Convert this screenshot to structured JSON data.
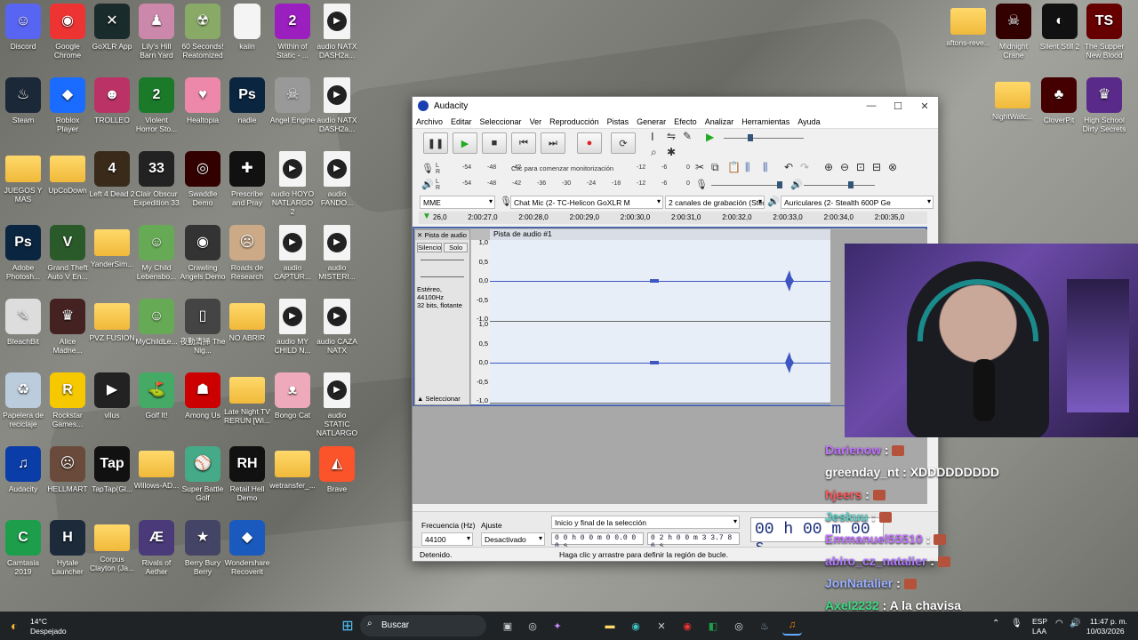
{
  "desktop_left": [
    {
      "label": "Discord",
      "bg": "#5865f2",
      "g": "☺"
    },
    {
      "label": "Google Chrome",
      "bg": "#e33",
      "g": "◉"
    },
    {
      "label": "GoXLR App",
      "bg": "#1a2b2b",
      "g": "✕"
    },
    {
      "label": "Lily's Hill Barn Yard",
      "bg": "#c8a",
      "g": "♟"
    },
    {
      "label": "60 Seconds! Reatomized",
      "bg": "#8a6",
      "g": "☢"
    },
    {
      "label": "kaiin",
      "file": true
    },
    {
      "label": "Within of Static - ...",
      "bg": "#9b1ebf",
      "g": "2"
    },
    {
      "label": "audio NATX DASH2a...",
      "audio": true
    },
    {
      "label": "Steam",
      "bg": "#1b2838",
      "g": "♨"
    },
    {
      "label": "Roblox Player",
      "bg": "#1a6bff",
      "g": "◆"
    },
    {
      "label": "TROLLEO",
      "bg": "#b36",
      "g": "☻"
    },
    {
      "label": "Violent Horror Sto...",
      "bg": "#1a7a2a",
      "g": "2"
    },
    {
      "label": "Healtopia",
      "bg": "#e8a",
      "g": "♥"
    },
    {
      "label": "nadie",
      "bg": "#0a2540",
      "g": "Ps"
    },
    {
      "label": "Angel Engine",
      "bg": "#999",
      "g": "☠"
    },
    {
      "label": "audio NATX DASH2a...",
      "audio": true
    },
    {
      "label": "JUEGOS Y MAS",
      "folder": true
    },
    {
      "label": "UpCoDown",
      "folder": true
    },
    {
      "label": "Left 4 Dead 2",
      "bg": "#3a2a1a",
      "g": "4"
    },
    {
      "label": "Clair Obscur Expedition 33",
      "bg": "#222",
      "g": "33"
    },
    {
      "label": "Swaddle Demo",
      "bg": "#300",
      "g": "◎"
    },
    {
      "label": "Prescribe and Pray",
      "bg": "#111",
      "g": "✚"
    },
    {
      "label": "audio HOYO NATLARGO 2",
      "audio": true
    },
    {
      "label": "audio FANDO...",
      "audio": true
    },
    {
      "label": "Adobe Photosh...",
      "bg": "#0a2540",
      "g": "Ps"
    },
    {
      "label": "Grand Theft Auto V En...",
      "bg": "#2a5a2a",
      "g": "V"
    },
    {
      "label": "YanderSim...",
      "folder": true
    },
    {
      "label": "My Child Lebensbo...",
      "bg": "#6a5",
      "g": "☺"
    },
    {
      "label": "Crawling Angels Demo",
      "bg": "#333",
      "g": "◉"
    },
    {
      "label": "Roads de Research",
      "bg": "#ca8",
      "g": "☹"
    },
    {
      "label": "audio CAPTUR...",
      "audio": true
    },
    {
      "label": "audio MISTERI...",
      "audio": true
    },
    {
      "label": "BleachBit",
      "bg": "#ddd",
      "g": "✎"
    },
    {
      "label": "Alice Madne...",
      "bg": "#422",
      "g": "♛"
    },
    {
      "label": "PVZ FUSION",
      "folder": true
    },
    {
      "label": "MyChildLe...",
      "bg": "#6a5",
      "g": "☺"
    },
    {
      "label": "夜勤清掃 The Nig...",
      "bg": "#444",
      "g": "▯"
    },
    {
      "label": "NO ABRIR",
      "folder": true
    },
    {
      "label": "audio MY CHILD N...",
      "audio": true
    },
    {
      "label": "audio CAZA NATX",
      "audio": true
    },
    {
      "label": "Papelera de reciclaje",
      "bg": "#bcd",
      "g": "♻"
    },
    {
      "label": "Rockstar Games...",
      "bg": "#f5c800",
      "g": "R"
    },
    {
      "label": "vilus",
      "bg": "#222",
      "g": "▶"
    },
    {
      "label": "Golf It!",
      "bg": "#4a6",
      "g": "⛳"
    },
    {
      "label": "Among Us",
      "bg": "#c00",
      "g": "☗"
    },
    {
      "label": "Late Night TV RERUN [Wi...",
      "folder": true
    },
    {
      "label": "Bongo Cat",
      "bg": "#eab",
      "g": "ᴥ"
    },
    {
      "label": "audio STATIC NATLARGO",
      "audio": true
    },
    {
      "label": "Audacity",
      "bg": "#0a3da8",
      "g": "♫"
    },
    {
      "label": "HELLMART",
      "bg": "#6a4a3a",
      "g": "☹"
    },
    {
      "label": "TapTap(Gl...",
      "bg": "#111",
      "g": "Tap"
    },
    {
      "label": "Willows-AD...",
      "folder": true
    },
    {
      "label": "Super Battle Golf",
      "bg": "#4a8",
      "g": "⚾"
    },
    {
      "label": "Retail Hell Demo",
      "bg": "#111",
      "g": "RH"
    },
    {
      "label": "wetransfer_...",
      "folder": true
    },
    {
      "label": "Brave",
      "bg": "#fb542b",
      "g": "◭"
    },
    {
      "label": "Camtasia 2019",
      "bg": "#1d9e4a",
      "g": "C"
    },
    {
      "label": "Hytale Launcher",
      "bg": "#1c2a3a",
      "g": "H"
    },
    {
      "label": "Corpus Clayton (Ja...",
      "folder": true
    },
    {
      "label": "Rivals of Aether",
      "bg": "#4a3a7a",
      "g": "Æ"
    },
    {
      "label": "Berry Bury Berry",
      "bg": "#446",
      "g": "★"
    },
    {
      "label": "Wondershare Recoverit",
      "bg": "#1a5abf",
      "g": "◆"
    }
  ],
  "desktop_right": [
    {
      "label": "aftons-reve...",
      "folder": true
    },
    {
      "label": "Midnight Crane",
      "bg": "#300",
      "g": "☠"
    },
    {
      "label": "Silent Still 2",
      "bg": "#111",
      "g": "◐"
    },
    {
      "label": "The Supper New Blood",
      "bg": "#600",
      "g": "TS"
    },
    {
      "label": "NightWatc...",
      "folder": true
    },
    {
      "label": "CloverPit",
      "bg": "#400",
      "g": "♣"
    },
    {
      "label": "High School Dirty Secrets",
      "bg": "#5a2a8a",
      "g": "♛"
    }
  ],
  "audacity": {
    "title": "Audacity",
    "menus": [
      "Archivo",
      "Editar",
      "Seleccionar",
      "Ver",
      "Reproducción",
      "Pistas",
      "Generar",
      "Efecto",
      "Analizar",
      "Herramientas",
      "Ayuda"
    ],
    "monitor_text": "Clic para comenzar monitorización",
    "meter_ticks": [
      "-54",
      "-48",
      "-42",
      "-36",
      "-30",
      "-24",
      "-18",
      "-12",
      "-6",
      "0"
    ],
    "host": "MME",
    "input_device": "Chat Mic (2- TC-Helicon GoXLR M",
    "channels": "2 canales de grabación (Ster",
    "output_device": "Auriculares (2- Stealth 600P Ge",
    "ruler": [
      "26,0",
      "2:00:27,0",
      "2:00:28,0",
      "2:00:29,0",
      "2:00:30,0",
      "2:00:31,0",
      "2:00:32,0",
      "2:00:33,0",
      "2:00:34,0",
      "2:00:35,0"
    ],
    "track_name": "Pista de audio #1",
    "track_menu": "Pista de audio",
    "mute": "Silencio",
    "solo": "Solo",
    "track_info": "Estéreo, 44100Hz",
    "track_info2": "32 bits, flotante",
    "select_btn": "Seleccionar",
    "scale": [
      "1,0",
      "0,5",
      "0,0",
      "-0,5",
      "-1,0"
    ],
    "rate_label": "Frecuencia (Hz)",
    "rate": "44100",
    "snap_label": "Ajuste",
    "snap": "Desactivado",
    "sel_label": "Inicio y final de la selección",
    "sel_start": "0 0 h 0 0 m 0 0.0 0 0 s",
    "sel_end": "0 2 h 0 0 m 3 3.7 8 6 s",
    "big_time": "00 h 00 m 00 s",
    "status_left": "Detenido.",
    "status_right": "Haga clic y arrastre para definir la región de bucle."
  },
  "chat": [
    {
      "user": "Darienow",
      "msg": "",
      "color": "#c070ff"
    },
    {
      "user": "greenday_nt",
      "msg": "XDDDDDDDDD",
      "color": "#ffffff"
    },
    {
      "user": "hjeers",
      "msg": "",
      "color": "#ff5a5a"
    },
    {
      "user": "Jeskuu",
      "msg": "",
      "color": "#5ad1c8"
    },
    {
      "user": "Emmanuel55510",
      "msg": "",
      "color": "#c070ff"
    },
    {
      "user": "abiro_cz_natalier",
      "msg": "",
      "color": "#b07aff"
    },
    {
      "user": "JonNatalier",
      "msg": "",
      "color": "#9aaeff"
    },
    {
      "user": "Axel2232",
      "msg": "A la chavisa",
      "color": "#3ddc84"
    }
  ],
  "taskbar": {
    "weather_temp": "14°C",
    "weather_desc": "Despejado",
    "search": "Buscar",
    "lang": "ESP",
    "lang2": "LAA",
    "time": "11:47 p. m.",
    "date": "10/03/2026"
  }
}
